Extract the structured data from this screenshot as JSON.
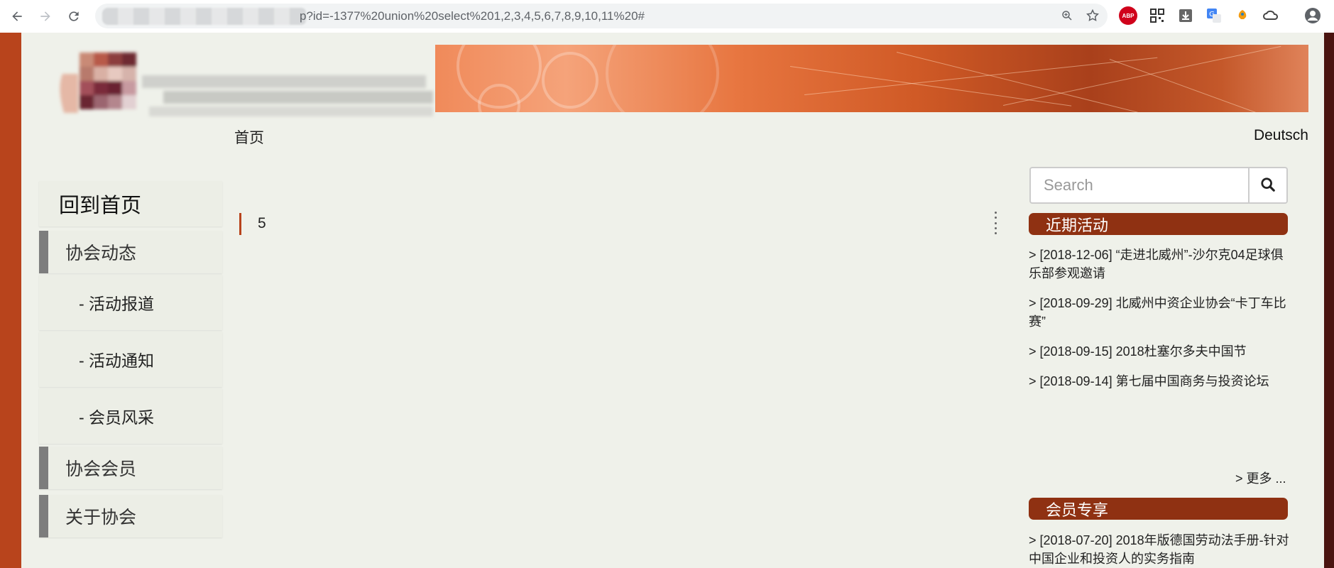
{
  "browser": {
    "url_suffix": "p?id=-1377%20union%20select%201,2,3,4,5,6,7,8,9,10,11%20#"
  },
  "colors": {
    "accent": "#b8441c",
    "section_header": "#8f3112",
    "page_bg": "#eff1ea"
  },
  "header": {
    "language_link": "Deutsch"
  },
  "breadcrumb": "首页",
  "sidebar": {
    "home": "回到首页",
    "items": [
      {
        "type": "category",
        "label": "协会动态"
      },
      {
        "type": "sub",
        "label": "- 活动报道"
      },
      {
        "type": "sub",
        "label": "- 活动通知"
      },
      {
        "type": "sub",
        "label": "- 会员风采"
      },
      {
        "type": "category",
        "label": "协会会员"
      },
      {
        "type": "category",
        "label": "关于协会"
      }
    ]
  },
  "content": {
    "value": "5"
  },
  "search": {
    "placeholder": "Search"
  },
  "recent_events": {
    "title": "近期活动",
    "items": [
      "> [2018-12-06] “走进北威州”-沙尔克04足球俱乐部参观邀请",
      "> [2018-09-29] 北威州中资企业协会“卡丁车比赛”",
      "> [2018-09-15] 2018杜塞尔多夫中国节",
      "> [2018-09-14] 第七届中国商务与投资论坛"
    ],
    "more": "> 更多 ..."
  },
  "members_only": {
    "title": "会员专享",
    "items": [
      "> [2018-07-20] 2018年版德国劳动法手册-针对中国企业和投资人的实务指南"
    ]
  }
}
